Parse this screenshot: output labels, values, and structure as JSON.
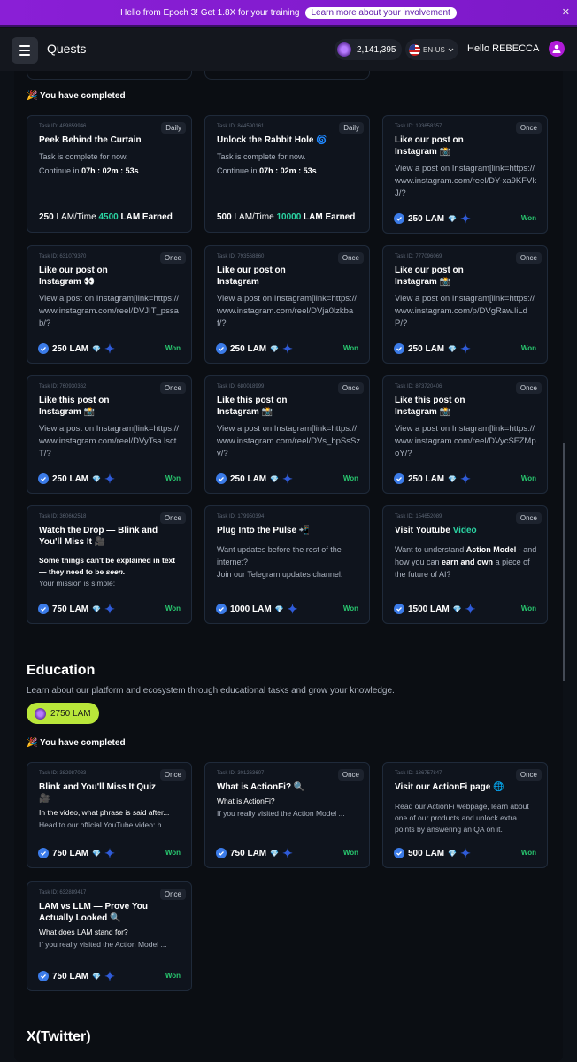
{
  "banner": {
    "text": "Hello from Epoch 3! Get 1.8X for your training",
    "link": "Learn more about your involvement",
    "close": "✕"
  },
  "header": {
    "title": "Quests",
    "balance": "2,141,395",
    "lang": "EN-US",
    "greeting": "Hello REBECCA"
  },
  "colors": {
    "accent": "#2bd4a3",
    "won": "#28c76f",
    "pill": "#b9e63a"
  },
  "completed_label": "🎉 You have completed",
  "daily_cards": [
    {
      "id": "Task ID: 489859946",
      "badge": "Daily",
      "title": "Peek Behind the Curtain",
      "status": "Task is complete for now.",
      "continue_prefix": "Continue in",
      "timer": "07h : 02m : 53s",
      "reward": "250",
      "per_time": "LAM/Time",
      "earned": "4500",
      "earned_suffix": "LAM Earned"
    },
    {
      "id": "Task ID: 844590161",
      "badge": "Daily",
      "title": "Unlock the Rabbit Hole 🌀",
      "status": "Task is complete for now.",
      "continue_prefix": "Continue in",
      "timer": "07h : 02m : 53s",
      "reward": "500",
      "per_time": "LAM/Time",
      "earned": "10000",
      "earned_suffix": "LAM Earned"
    }
  ],
  "quest_cards": [
    {
      "id": "Task ID: 193658357",
      "badge": "Once",
      "title": "Like our post on Instagram 📸",
      "desc": "View a post on Instagram[link=https://www.instagram.com/reel/DY-xa9KFVkJ/?",
      "reward": "250 LAM",
      "won": "Won"
    },
    {
      "id": "Task ID: 631079370",
      "badge": "Once",
      "title": "Like our post on Instagram 👀",
      "desc": "View a post on Instagram[link=https://www.instagram.com/reel/DVJIT_pssab/?",
      "reward": "250 LAM",
      "won": "Won"
    },
    {
      "id": "Task ID: 793568860",
      "badge": "Once",
      "title": "Like our post on Instagram",
      "desc": "View a post on Instagram[link=https://www.instagram.com/reel/DVja0lzkbaf/?",
      "reward": "250 LAM",
      "won": "Won"
    },
    {
      "id": "Task ID: 777096069",
      "badge": "Once",
      "title": "Like our post on Instagram 📸",
      "desc": "View a post on Instagram[link=https://www.instagram.com/p/DVgRaw.liLdP/?",
      "reward": "250 LAM",
      "won": "Won"
    },
    {
      "id": "Task ID: 760930362",
      "badge": "Once",
      "title": "Like this post on Instagram 📸",
      "desc": "View a post on Instagram[link=https://www.instagram.com/reel/DVyTsa.lsctT/?",
      "reward": "250 LAM",
      "won": "Won"
    },
    {
      "id": "Task ID: 680018999",
      "badge": "Once",
      "title": "Like this post on Instagram 📸",
      "desc": "View a post on Instagram[link=https://www.instagram.com/reel/DVs_bpSsSzv/?",
      "reward": "250 LAM",
      "won": "Won"
    },
    {
      "id": "Task ID: 873720406",
      "badge": "Once",
      "title": "Like this post on Instagram 📸",
      "desc": "View a post on Instagram[link=https://www.instagram.com/reel/DVycSFZMpoY/?",
      "reward": "250 LAM",
      "won": "Won"
    }
  ],
  "watch": {
    "id": "Task ID: 360662518",
    "badge": "Once",
    "title": "Watch the Drop — Blink and You'll Miss It 🎥",
    "desc_1": "Some things can't be explained in text — they need to be ",
    "desc_em": "seen.",
    "desc_2": "Your mission is simple:",
    "reward": "750 LAM",
    "won": "Won"
  },
  "pulse": {
    "id": "Task ID: 179950394",
    "badge": "",
    "title": "Plug Into the Pulse 📲",
    "desc_1": "Want updates before the rest of the internet?",
    "desc_2": "Join our Telegram updates channel.",
    "reward": "1000 LAM",
    "won": "Won"
  },
  "youtube": {
    "id": "Task ID: 154652089",
    "badge": "Once",
    "title_1": "Visit Youtube ",
    "title_green": "Video",
    "desc_1": "Want to understand ",
    "desc_b1": "Action Model",
    "desc_2": " - and how you can ",
    "desc_b2": "earn and own",
    "desc_3": " a piece of the future of AI?",
    "reward": "1500 LAM",
    "won": "Won"
  },
  "education": {
    "title": "Education",
    "desc": "Learn about our platform and ecosystem through educational tasks and grow your knowledge.",
    "total": "2750 LAM"
  },
  "edu_cards": [
    {
      "id": "Task ID: 382987083",
      "badge": "Once",
      "title": "Blink and You'll Miss It Quiz 🎥",
      "line1": "In the video, what phrase is said after...",
      "line2": "Head to our official YouTube video: h...",
      "reward": "750 LAM",
      "won": "Won"
    },
    {
      "id": "Task ID: 301263607",
      "badge": "Once",
      "title": "What is ActionFi? 🔍",
      "line1": "What is ActionFi?",
      "line2": "If you really visited the Action Model ...",
      "reward": "750 LAM",
      "won": "Won"
    },
    {
      "id": "Task ID: 136757847",
      "badge": "Once",
      "title": "Visit our ActionFi page 🌐",
      "line1": "Read our ActionFi webpage, learn about one of our products and unlock extra points by answering an QA on it.",
      "line2": "",
      "reward": "500 LAM",
      "won": "Won"
    },
    {
      "id": "Task ID: 632889417",
      "badge": "Once",
      "title": "LAM vs LLM — Prove You Actually Looked 🔍",
      "line1": "What does LAM stand for?",
      "line2": "If you really visited the Action Model ...",
      "reward": "750 LAM",
      "won": "Won"
    }
  ],
  "twitter": {
    "title": "X(Twitter)"
  }
}
